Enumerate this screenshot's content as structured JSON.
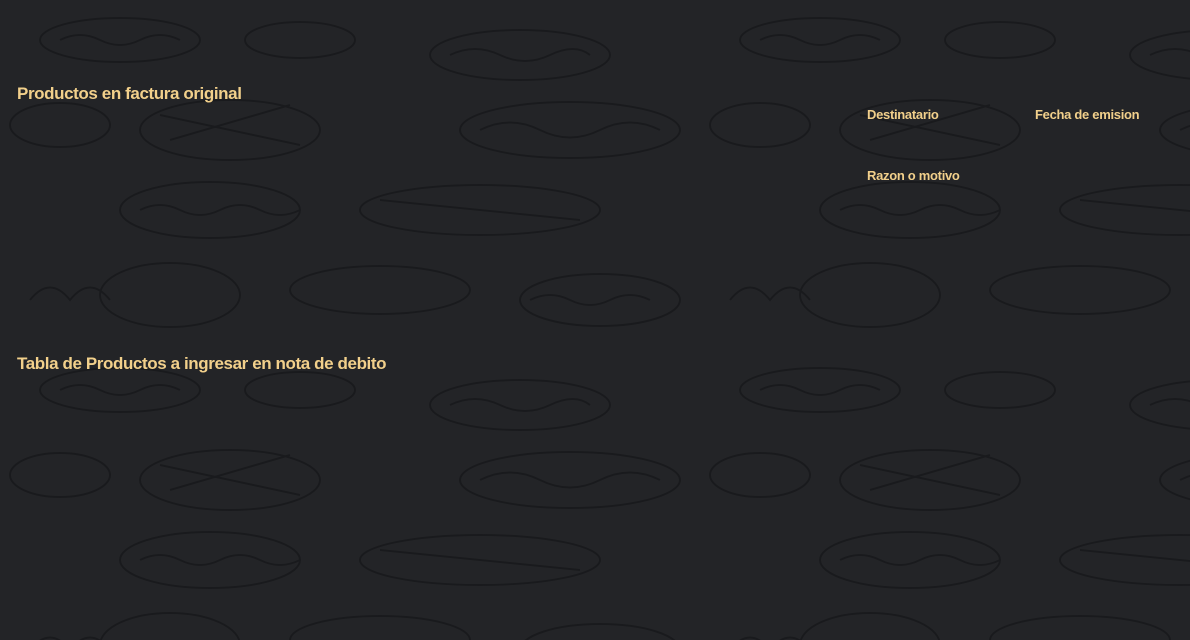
{
  "theme": {
    "background": "#232427",
    "accent_text": "#f2d08b",
    "sketch_stroke": "#17181a"
  },
  "original_products": {
    "title": "Productos en factura original"
  },
  "form": {
    "recipient_label": "Destinatario",
    "issue_date_label": "Fecha de emision",
    "reason_label": "Razon o motivo"
  },
  "debit_products": {
    "title": "Tabla de Productos a ingresar en nota de debito"
  }
}
